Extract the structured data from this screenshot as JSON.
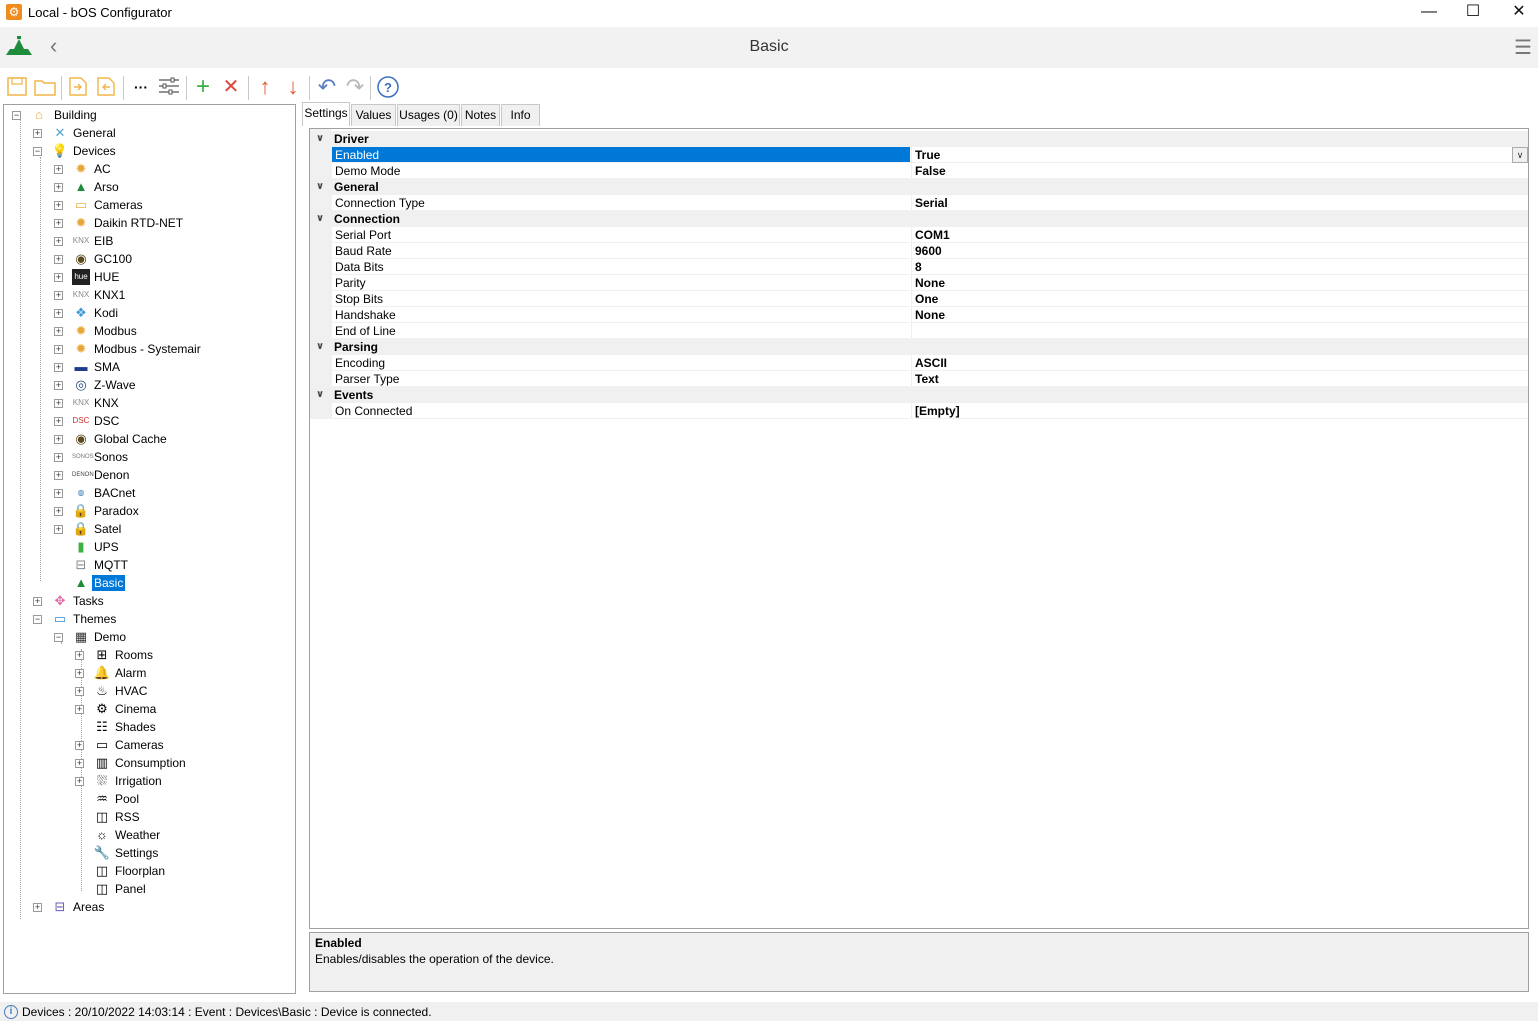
{
  "window": {
    "title": "Local - bOS Configurator",
    "controls": [
      "minimize-icon",
      "maximize-icon",
      "close-icon"
    ]
  },
  "header": {
    "page_title": "Basic",
    "back_icon": "chevron-left-icon",
    "menu_icon": "hamburger-menu-icon"
  },
  "toolbar": {
    "buttons": [
      "save-icon",
      "open-folder-icon",
      "import-icon",
      "export-icon",
      "more-icon",
      "settings-sliders-icon",
      "add-icon",
      "delete-icon",
      "move-up-icon",
      "move-down-icon",
      "undo-icon",
      "redo-icon",
      "help-icon"
    ],
    "more_label": "···"
  },
  "tree": {
    "building": "Building",
    "general": "General",
    "devices": "Devices",
    "device_items": [
      "AC",
      "Arso",
      "Cameras",
      "Daikin RTD-NET",
      "EIB",
      "GC100",
      "HUE",
      "KNX1",
      "Kodi",
      "Modbus",
      "Modbus - Systemair",
      "SMA",
      "Z-Wave",
      "KNX",
      "DSC",
      "Global Cache",
      "Sonos",
      "Denon",
      "BACnet",
      "Paradox",
      "Satel",
      "UPS",
      "MQTT",
      "Basic"
    ],
    "tasks": "Tasks",
    "themes": "Themes",
    "demo": "Demo",
    "demo_items": [
      "Rooms",
      "Alarm",
      "HVAC",
      "Cinema",
      "Shades",
      "Cameras",
      "Consumption",
      "Irrigation",
      "Pool",
      "RSS",
      "Weather",
      "Settings",
      "Floorplan",
      "Panel"
    ],
    "areas": "Areas",
    "selected": "Basic"
  },
  "tabs": [
    "Settings",
    "Values",
    "Usages (0)",
    "Notes",
    "Info"
  ],
  "active_tab": "Settings",
  "properties": {
    "cat_driver": "Driver",
    "enabled_name": "Enabled",
    "enabled_value": "True",
    "demo_name": "Demo Mode",
    "demo_value": "False",
    "cat_general": "General",
    "conn_type_name": "Connection Type",
    "conn_type_value": "Serial",
    "cat_connection": "Connection",
    "serial_port_name": "Serial Port",
    "serial_port_value": "COM1",
    "baud_name": "Baud Rate",
    "baud_value": "9600",
    "databits_name": "Data Bits",
    "databits_value": "8",
    "parity_name": "Parity",
    "parity_value": "None",
    "stopbits_name": "Stop Bits",
    "stopbits_value": "One",
    "handshake_name": "Handshake",
    "handshake_value": "None",
    "eol_name": "End of Line",
    "eol_value": "",
    "cat_parsing": "Parsing",
    "encoding_name": "Encoding",
    "encoding_value": "ASCII",
    "parser_name": "Parser Type",
    "parser_value": "Text",
    "cat_events": "Events",
    "onconn_name": "On Connected",
    "onconn_value": "[Empty]"
  },
  "help": {
    "title": "Enabled",
    "description": "Enables/disables the operation of the device."
  },
  "status": {
    "text": "Devices : 20/10/2022 14:03:14 : Event : Devices\\Basic : Device is connected."
  }
}
